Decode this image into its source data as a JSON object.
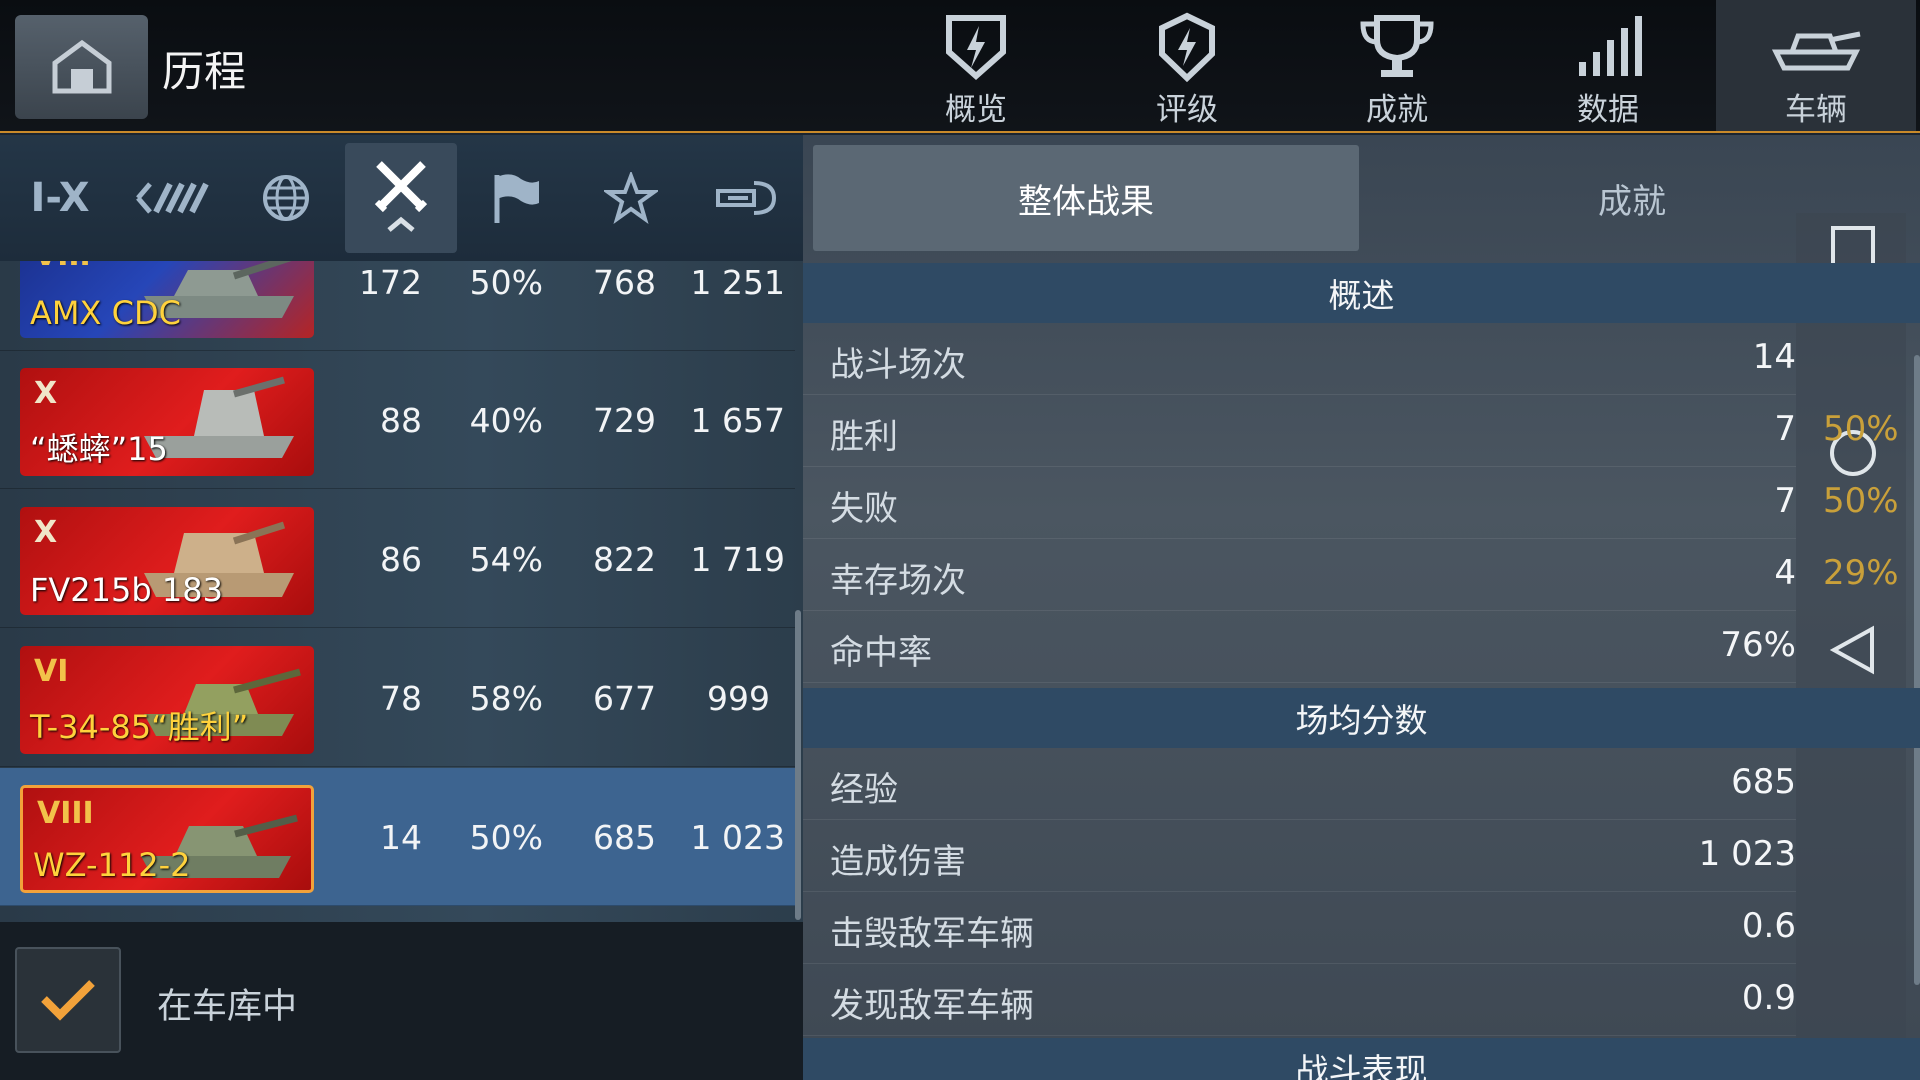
{
  "header": {
    "title": "历程",
    "tabs": [
      {
        "label": "概览",
        "icon": "shield-bolt-icon",
        "active": false
      },
      {
        "label": "评级",
        "icon": "rating-badge-icon",
        "active": false
      },
      {
        "label": "成就",
        "icon": "trophy-icon",
        "active": false
      },
      {
        "label": "数据",
        "icon": "bar-signal-icon",
        "active": false
      },
      {
        "label": "车辆",
        "icon": "tank-icon",
        "active": true
      }
    ]
  },
  "filters": [
    {
      "label": "I-X",
      "icon": "tier-filter"
    },
    {
      "icon": "nation-chevrons-icon"
    },
    {
      "icon": "globe-icon"
    },
    {
      "icon": "crossed-swords-icon",
      "active": true
    },
    {
      "icon": "flag-icon"
    },
    {
      "icon": "star-icon"
    },
    {
      "icon": "gun-icon"
    }
  ],
  "vehicles": [
    {
      "tier": "VIII",
      "name": "AMX CDC",
      "battles": "172",
      "winrate": "50%",
      "xp": "768",
      "damage": "1 251",
      "gold": true,
      "card": "blue"
    },
    {
      "tier": "X",
      "name": "“蟋蟀”15",
      "battles": "88",
      "winrate": "40%",
      "xp": "729",
      "damage": "1 657",
      "gold": false,
      "card": "red"
    },
    {
      "tier": "X",
      "name": "FV215b 183",
      "battles": "86",
      "winrate": "54%",
      "xp": "822",
      "damage": "1 719",
      "gold": false,
      "card": "red"
    },
    {
      "tier": "VI",
      "name": "T-34-85“胜利”",
      "battles": "78",
      "winrate": "58%",
      "xp": "677",
      "damage": "999",
      "gold": true,
      "card": "red"
    },
    {
      "tier": "VIII",
      "name": "WZ-112-2",
      "battles": "14",
      "winrate": "50%",
      "xp": "685",
      "damage": "1 023",
      "gold": true,
      "card": "red",
      "selected": true
    }
  ],
  "garage": {
    "label": "在车库中",
    "checked": true
  },
  "panel": {
    "seg_active": "整体战果",
    "seg_inactive": "成就",
    "overview_title": "概述",
    "overview": [
      {
        "label": "战斗场次",
        "value": "14",
        "pct": ""
      },
      {
        "label": "胜利",
        "value": "7",
        "pct": "50%"
      },
      {
        "label": "失败",
        "value": "7",
        "pct": "50%"
      },
      {
        "label": "幸存场次",
        "value": "4",
        "pct": "29%"
      },
      {
        "label": "命中率",
        "value": "76%",
        "pct": ""
      }
    ],
    "avg_title": "场均分数",
    "avg": [
      {
        "label": "经验",
        "value": "685"
      },
      {
        "label": "造成伤害",
        "value": "1 023"
      },
      {
        "label": "击毁敌军车辆",
        "value": "0.6"
      },
      {
        "label": "发现敌军车辆",
        "value": "0.9"
      }
    ],
    "perf_title": "战斗表现"
  }
}
